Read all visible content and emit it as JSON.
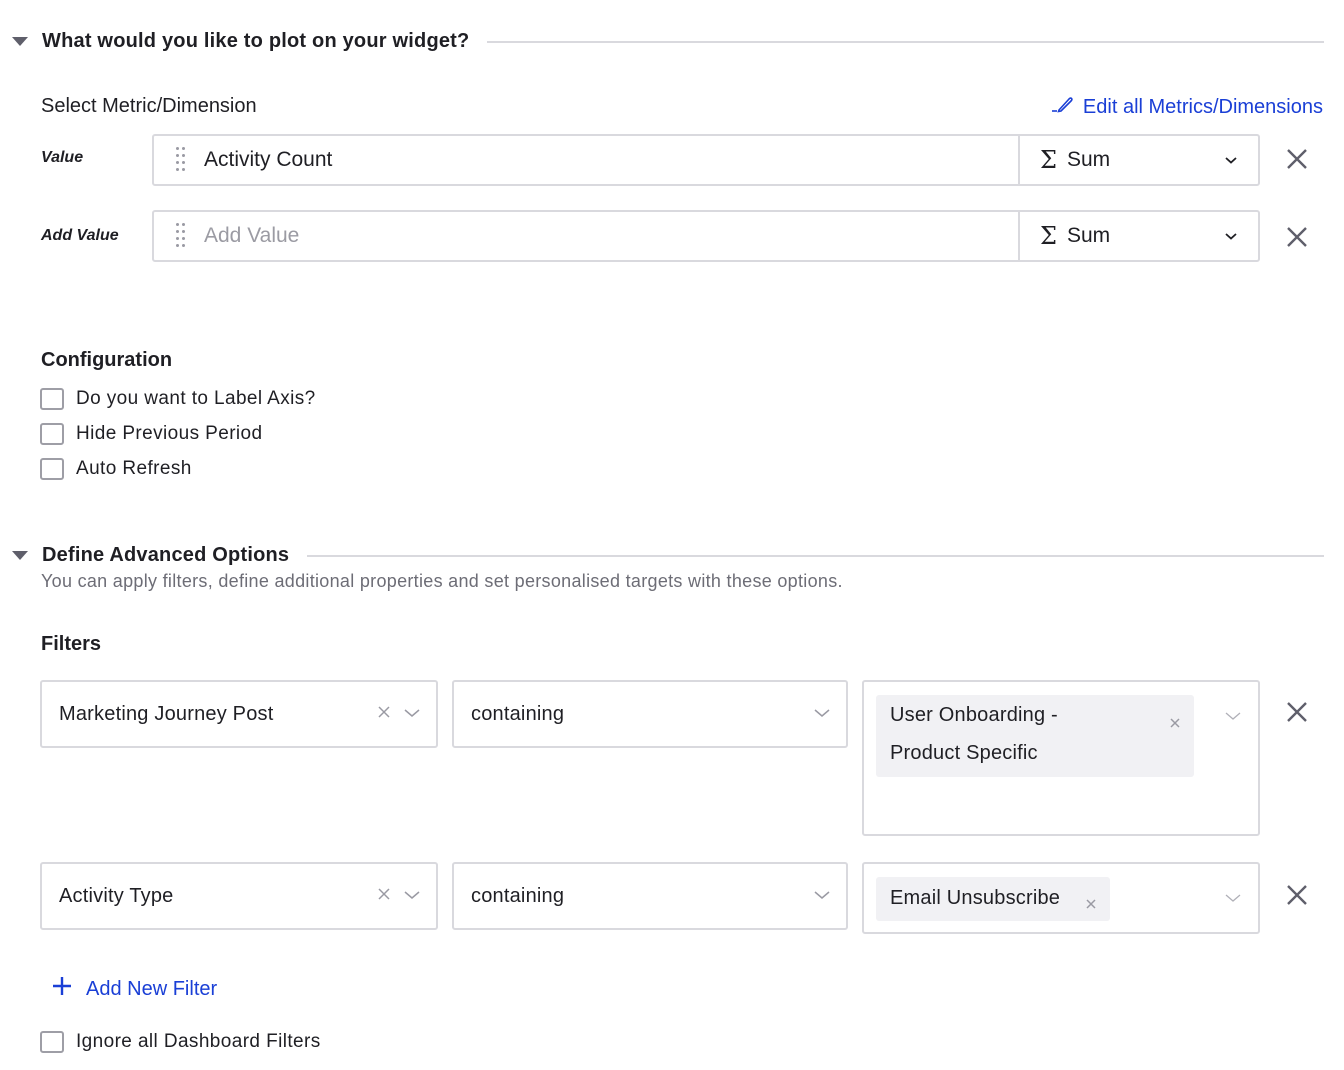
{
  "plot_section": {
    "title": "What would you like to plot on your widget?",
    "select_label": "Select Metric/Dimension",
    "edit_link": "Edit all Metrics/Dimensions",
    "rows": [
      {
        "label": "Value",
        "value": "Activity Count",
        "placeholder": "",
        "aggregation": "Sum",
        "aggregation_icon": "Σ"
      },
      {
        "label": "Add Value",
        "value": "",
        "placeholder": "Add Value",
        "aggregation": "Sum",
        "aggregation_icon": "Σ"
      }
    ]
  },
  "configuration": {
    "title": "Configuration",
    "options": [
      {
        "label": "Do you want to Label Axis?",
        "checked": false
      },
      {
        "label": "Hide Previous Period",
        "checked": false
      },
      {
        "label": "Auto Refresh",
        "checked": false
      }
    ]
  },
  "advanced_section": {
    "title": "Define Advanced Options",
    "subtitle": "You can apply filters, define additional properties and set personalised targets with these options.",
    "filters_title": "Filters",
    "filters": [
      {
        "field": "Marketing Journey Post",
        "operator": "containing",
        "values": [
          "User Onboarding - Product Specific"
        ],
        "value_lines": [
          "User Onboarding -",
          "Product Specific"
        ]
      },
      {
        "field": "Activity Type",
        "operator": "containing",
        "values": [
          "Email Unsubscribe"
        ],
        "value_lines": [
          "Email Unsubscribe"
        ]
      }
    ],
    "add_filter_label": "Add New Filter",
    "ignore_dashboard_filters": {
      "label": "Ignore all Dashboard Filters",
      "checked": false
    }
  },
  "colors": {
    "link": "#1a3fd6",
    "border": "#d9d9de",
    "tag_bg": "#f1f1f4",
    "text": "#1f1f24",
    "muted": "#6d6d76"
  }
}
